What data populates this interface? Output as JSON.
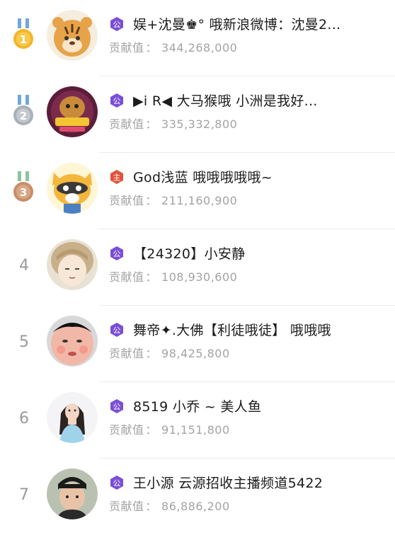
{
  "contribution_label": "贡献值",
  "label_separator": "：",
  "colors": {
    "gold": "#f3b52a",
    "silver": "#a9b0b8",
    "bronze": "#c88d6a",
    "fan_badge": "#7b4ed8",
    "host_badge": "#e0533b",
    "rank_number": "#9a9a9a",
    "contribution_text": "#a3a3a3"
  },
  "rows": [
    {
      "rank": "1",
      "medal": "gold-medal",
      "badge": "fan-badge",
      "badge_text": "公",
      "name": "娱+沈曼♚° 哦新浪微博：沈曼2...",
      "contribution": "344,268,000",
      "avatar_icon": "tiger-avatar"
    },
    {
      "rank": "2",
      "medal": "silver-medal",
      "badge": "fan-badge",
      "badge_text": "公",
      "name": "▶i R◀ 大马猴哦 小洲是我好...",
      "contribution": "335,332,800",
      "avatar_icon": "monkey-king-avatar"
    },
    {
      "rank": "3",
      "medal": "bronze-medal",
      "badge": "host-badge",
      "badge_text": "主",
      "name": "God浅蓝 哦哦哦哦哦~",
      "contribution": "211,160,900",
      "avatar_icon": "raccoon-avatar"
    },
    {
      "rank": "4",
      "medal": "",
      "badge": "fan-badge",
      "badge_text": "公",
      "name": "【24320】小安静",
      "contribution": "108,930,600",
      "avatar_icon": "anime-girl-avatar"
    },
    {
      "rank": "5",
      "medal": "",
      "badge": "fan-badge",
      "badge_text": "公",
      "name": "舞帝✦.大佛【利徒哦徒】 哦哦哦",
      "contribution": "98,425,800",
      "avatar_icon": "funny-face-avatar"
    },
    {
      "rank": "6",
      "medal": "",
      "badge": "fan-badge",
      "badge_text": "公",
      "name": "8519 小乔 ~ 美人鱼",
      "contribution": "91,151,800",
      "avatar_icon": "woman-avatar"
    },
    {
      "rank": "7",
      "medal": "",
      "badge": "fan-badge",
      "badge_text": "公",
      "name": "王小源 云源招收主播频道5422",
      "contribution": "86,886,200",
      "avatar_icon": "man-avatar"
    }
  ]
}
